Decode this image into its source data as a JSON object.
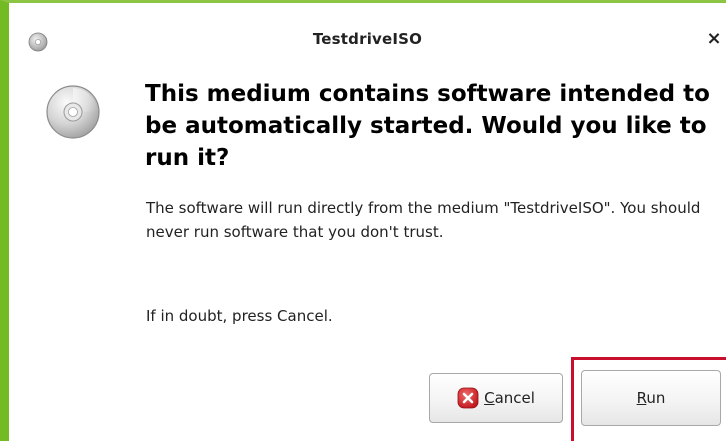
{
  "window": {
    "title": "TestdriveISO",
    "close_glyph": "×",
    "title_icon": "optical-disc-icon"
  },
  "dialog": {
    "icon": "optical-disc-icon",
    "headline": "This medium contains software intended to be automatically started. Would you like to run it?",
    "body": "The software will run directly from the medium \"TestdriveISO\". You should never run software that you don't trust.",
    "hint": "If in doubt, press Cancel."
  },
  "buttons": {
    "cancel": {
      "mnemonic": "C",
      "rest": "ancel",
      "icon": "cancel-x-icon"
    },
    "run": {
      "mnemonic": "R",
      "rest": "un",
      "highlighted": true
    }
  },
  "colors": {
    "window_border": "#73ba25",
    "highlight_box": "#c8102e",
    "cancel_icon": "#d9262c"
  }
}
